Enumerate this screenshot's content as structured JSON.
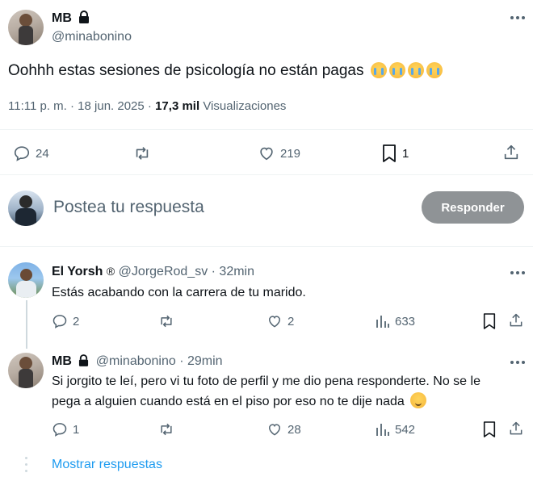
{
  "post": {
    "author_name": "MB",
    "author_handle": "@minabonino",
    "text": "Oohhh estas sesiones de psicología no están pagas",
    "emoji": [
      "loudly-crying-face",
      "loudly-crying-face",
      "loudly-crying-face",
      "loudly-crying-face"
    ],
    "time": "11:11 p. m.",
    "separator": "·",
    "date": "18 jun. 2025",
    "views_count": "17,3 mil",
    "views_label": "Visualizaciones",
    "actions": {
      "replies": "24",
      "reposts": "",
      "likes": "219",
      "bookmarks": "1"
    }
  },
  "composer": {
    "placeholder": "Postea tu respuesta",
    "button": "Responder"
  },
  "replies": [
    {
      "author_name": "El Yorsh",
      "badge": "®",
      "author_handle": "@JorgeRod_sv",
      "separator": "·",
      "time": "32min",
      "text": "Estás acabando con la carrera de tu marido.",
      "actions": {
        "replies": "2",
        "reposts": "",
        "likes": "2",
        "views": "633"
      }
    },
    {
      "author_name": "MB",
      "author_handle": "@minabonino",
      "separator": "·",
      "time": "29min",
      "text_line1": "Si jorgito te leí, pero vi tu foto de perfil y me dio pena responderte. No se le",
      "text_line2": "pega a alguien cuando está en el piso por eso no te dije nada",
      "emoji": "relieved-face",
      "actions": {
        "replies": "1",
        "reposts": "",
        "likes": "28",
        "views": "542"
      }
    }
  ],
  "show_more": "Mostrar respuestas",
  "colors": {
    "text": "#0f1419",
    "muted": "#536471",
    "link": "#1d9bf0",
    "button_disabled": "#8f9396",
    "divider": "#eff3f4"
  }
}
